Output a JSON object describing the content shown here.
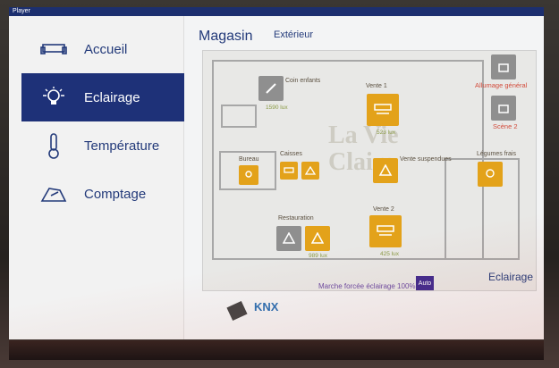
{
  "window": {
    "title": "Player"
  },
  "nav": {
    "items": [
      {
        "label": "Accueil",
        "icon": "couch-icon"
      },
      {
        "label": "Eclairage",
        "icon": "bulb-icon",
        "active": true
      },
      {
        "label": "Température",
        "icon": "thermometer-icon"
      },
      {
        "label": "Comptage",
        "icon": "meter-icon"
      }
    ]
  },
  "header": {
    "tab_active": "Magasin",
    "tab_other": "Extérieur"
  },
  "plan": {
    "watermark": "La Vie\nClaire",
    "labels": {
      "coin_enfants": "Coin enfants",
      "vente1": "Vente 1",
      "allumage": "Allumage général",
      "bureau": "Bureau",
      "caisses": "Caisses",
      "vente_susp": "Vente suspendues",
      "legumes": "Légumes frais",
      "vente2": "Vente 2",
      "restauration": "Restauration",
      "scene2": "Scène 2"
    },
    "lux": {
      "coin_enfants": "1590 lux",
      "vente1": "523 lux",
      "restauration": "989 lux",
      "vente2": "425 lux"
    }
  },
  "footer": {
    "forced_text": "Marche forcée éclairage 100%",
    "auto_label": "Auto",
    "section_title": "Eclairage",
    "knx_logo": "KNX"
  },
  "colors": {
    "accent": "#1e3178",
    "tile_on": "#e3a21a",
    "tile_off": "#8f8f8f",
    "alert": "#d24a3a"
  }
}
